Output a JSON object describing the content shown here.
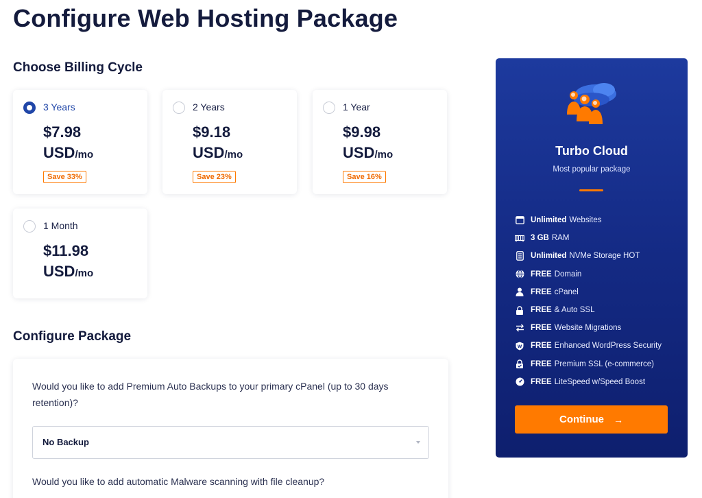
{
  "page": {
    "title": "Configure Web Hosting Package"
  },
  "billing": {
    "heading": "Choose Billing Cycle",
    "options": [
      {
        "label": "3 Years",
        "price": "$7.98",
        "currency": "USD",
        "period": "/mo",
        "save": "Save 33%",
        "selected": true
      },
      {
        "label": "2 Years",
        "price": "$9.18",
        "currency": "USD",
        "period": "/mo",
        "save": "Save 23%",
        "selected": false
      },
      {
        "label": "1 Year",
        "price": "$9.98",
        "currency": "USD",
        "period": "/mo",
        "save": "Save 16%",
        "selected": false
      },
      {
        "label": "1 Month",
        "price": "$11.98",
        "currency": "USD",
        "period": "/mo",
        "save": "",
        "selected": false
      }
    ]
  },
  "configure": {
    "heading": "Configure Package",
    "backup_question": "Would you like to add Premium Auto Backups to your primary cPanel (up to 30 days retention)?",
    "backup_selected": "No Backup",
    "malware_question": "Would you like to add automatic Malware scanning with file cleanup?"
  },
  "summary": {
    "package_name": "Turbo Cloud",
    "package_subtitle": "Most popular package",
    "features": [
      {
        "icon": "window-icon",
        "bold": "Unlimited",
        "text": "Websites"
      },
      {
        "icon": "memory-icon",
        "bold": "3 GB",
        "text": "RAM"
      },
      {
        "icon": "storage-icon",
        "bold": "Unlimited",
        "text": "NVMe Storage  HOT"
      },
      {
        "icon": "globe-icon",
        "bold": "FREE",
        "text": "Domain"
      },
      {
        "icon": "user-icon",
        "bold": "FREE",
        "text": "cPanel"
      },
      {
        "icon": "lock-icon",
        "bold": "FREE",
        "text": "& Auto SSL"
      },
      {
        "icon": "transfer-icon",
        "bold": "FREE",
        "text": "Website Migrations"
      },
      {
        "icon": "shield-icon",
        "bold": "FREE",
        "text": "Enhanced WordPress Security"
      },
      {
        "icon": "lock-check-icon",
        "bold": "FREE",
        "text": "Premium SSL (e-commerce)"
      },
      {
        "icon": "speedometer-icon",
        "bold": "FREE",
        "text": "LiteSpeed w/Speed Boost"
      }
    ],
    "continue_label": "Continue",
    "continue_arrow": "→"
  },
  "colors": {
    "primary": "#2046a8",
    "accent": "#ff7a00",
    "panel": "#142a84",
    "heading": "#141b3d"
  }
}
